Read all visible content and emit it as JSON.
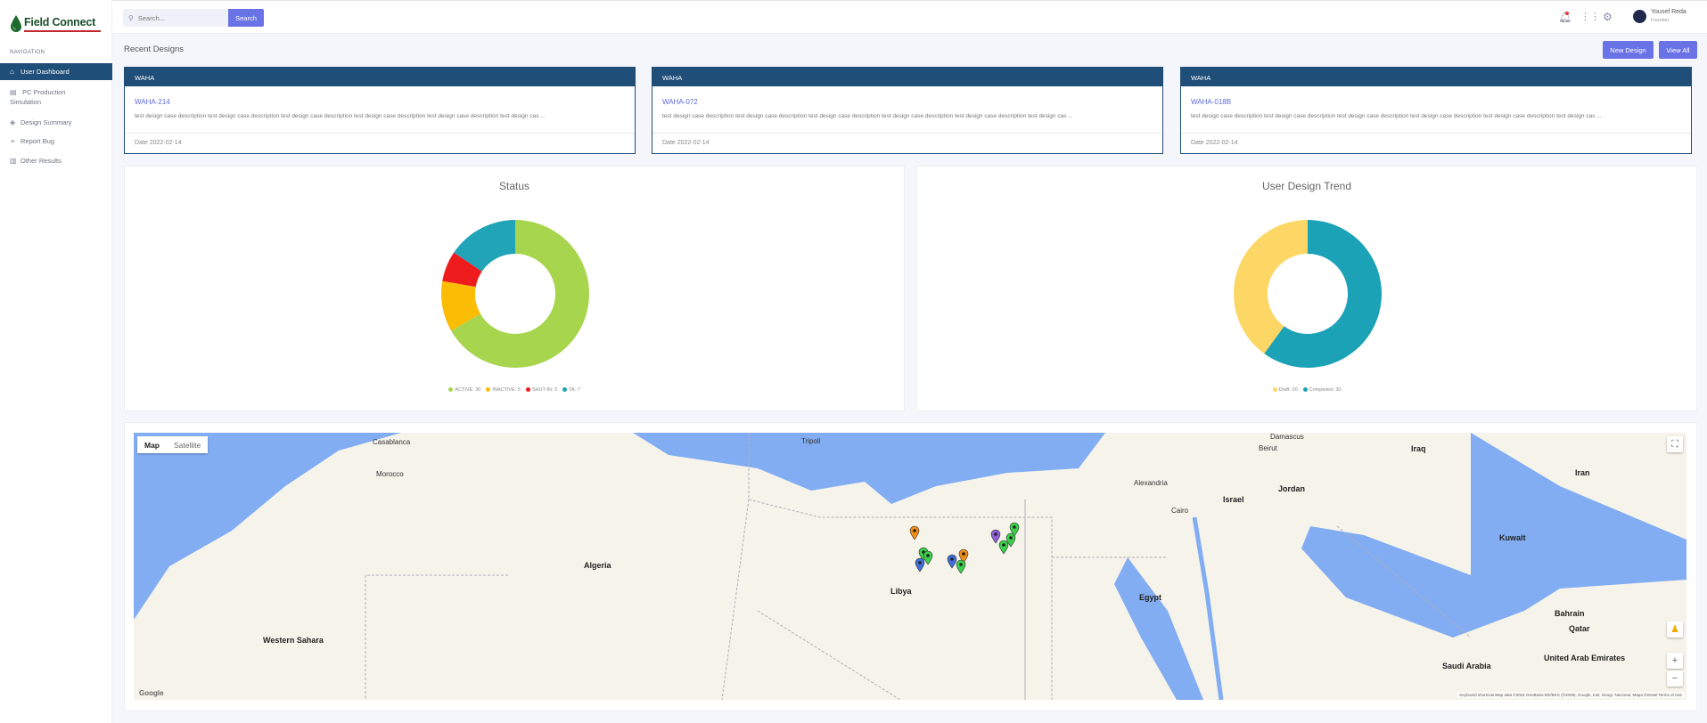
{
  "app": {
    "logo_text": "Field Connect"
  },
  "sidebar": {
    "heading": "NAVIGATION",
    "items": [
      {
        "label": "User Dashboard",
        "icon": "home-icon",
        "active": true
      },
      {
        "label": "PC Production",
        "label2": "Simulation",
        "icon": "document-icon"
      },
      {
        "label": "Design Summary",
        "icon": "layers-icon"
      },
      {
        "label": "Report Bug",
        "icon": "send-icon"
      },
      {
        "label": "Other Results",
        "icon": "database-icon"
      }
    ]
  },
  "topbar": {
    "search_placeholder": "Search...",
    "search_label": "Search",
    "user_name": "Yousef Reda",
    "user_role": "Founder"
  },
  "recent": {
    "title": "Recent Designs",
    "new_label": "New Design",
    "view_all_label": "View All",
    "cards": [
      {
        "header": "WAHA",
        "id": "WAHA-214",
        "desc": "test design case description test design case description test design case description test design case description test design case description test design cas ...",
        "date": "Date 2022-02-14"
      },
      {
        "header": "WAHA",
        "id": "WAHA-072",
        "desc": "test design case description test design case description test design case description test design case description test design case description test design cas ...",
        "date": "Date 2022-02-14"
      },
      {
        "header": "WAHA",
        "id": "WAHA-018B",
        "desc": "test design case description test design case description test design case description test design case description test design case description test design cas ...",
        "date": "Date 2022-02-14"
      }
    ]
  },
  "chart_data": [
    {
      "type": "pie",
      "title": "Status",
      "categories": [
        "ACTIVE: 30",
        "INACTIVE: 5",
        "SHUT-IN: 3",
        "TA: 7"
      ],
      "values": [
        30,
        5,
        3,
        7
      ],
      "colors": [
        "#a8d54e",
        "#fbbc05",
        "#ee1c1c",
        "#21a3b8"
      ],
      "start_category": "ACTIVE: 30",
      "donut": true,
      "legend": "bottom"
    },
    {
      "type": "pie",
      "title": "User Design Trend",
      "categories": [
        "Draft: 20",
        "Completed: 30"
      ],
      "values": [
        20,
        30
      ],
      "colors": [
        "#fdd765",
        "#1ba2b6"
      ],
      "start_category": "Completed: 30",
      "donut": true,
      "legend": "bottom"
    }
  ],
  "map": {
    "type_map": "Map",
    "type_satellite": "Satellite",
    "attribution": "Keyboard shortcuts   Map data ©2022 GeoBasis-DE/BKG (©2009), Google, Inst. Geogr. Nacional, Mapa GISrael   Terms of Use",
    "labels": [
      "Morocco",
      "Algeria",
      "Libya",
      "Egypt",
      "Western Sahara",
      "Saudi Arabia",
      "Israel",
      "Jordan",
      "Iraq",
      "Iran",
      "Kuwait",
      "Qatar",
      "Bahrain",
      "United Arab Emirates",
      "Tripoli",
      "Casablanca",
      "Damascus",
      "Beirut",
      "Cairo",
      "Alexandria"
    ],
    "markers": [
      "orange",
      "green",
      "blue",
      "green",
      "orange",
      "green",
      "blue",
      "green",
      "green",
      "purple",
      "green"
    ]
  }
}
